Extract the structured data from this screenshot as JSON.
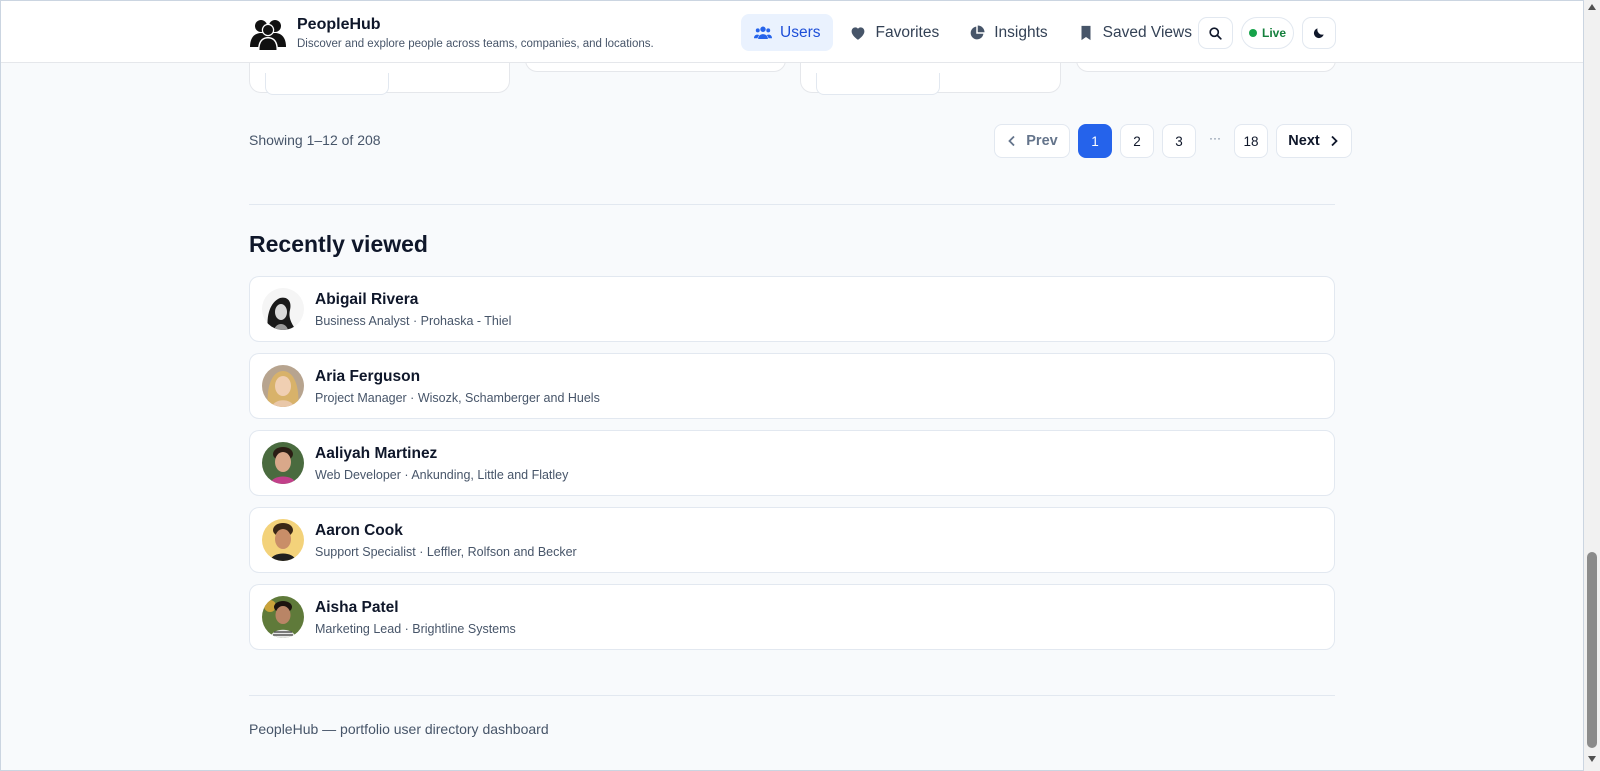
{
  "app": {
    "title": "PeopleHub",
    "subtitle": "Discover and explore people across teams, companies, and locations."
  },
  "nav": {
    "items": [
      {
        "label": "Users",
        "icon": "users-icon",
        "active": true
      },
      {
        "label": "Favorites",
        "icon": "heart-icon",
        "active": false
      },
      {
        "label": "Insights",
        "icon": "pie-chart-icon",
        "active": false
      },
      {
        "label": "Saved Views",
        "icon": "bookmark-icon",
        "active": false
      }
    ]
  },
  "header_actions": {
    "live_label": "Live"
  },
  "pagination": {
    "showing": "Showing 1–12 of 208",
    "prev_label": "Prev",
    "next_label": "Next",
    "pages": [
      "1",
      "2",
      "3"
    ],
    "ellipsis": "···",
    "last_page": "18",
    "current": "1"
  },
  "recently_viewed": {
    "title": "Recently viewed",
    "items": [
      {
        "name": "Abigail Rivera",
        "meta": "Business Analyst · Prohaska - Thiel"
      },
      {
        "name": "Aria Ferguson",
        "meta": "Project Manager · Wisozk, Schamberger and Huels"
      },
      {
        "name": "Aaliyah Martinez",
        "meta": "Web Developer · Ankunding, Little and Flatley"
      },
      {
        "name": "Aaron Cook",
        "meta": "Support Specialist · Leffler, Rolfson and Becker"
      },
      {
        "name": "Aisha Patel",
        "meta": "Marketing Lead · Brightline Systems"
      }
    ]
  },
  "footer": {
    "text": "PeopleHub — portfolio user directory dashboard"
  },
  "colors": {
    "accent": "#2563eb",
    "live": "#16a34a",
    "background": "#f8fafc"
  }
}
